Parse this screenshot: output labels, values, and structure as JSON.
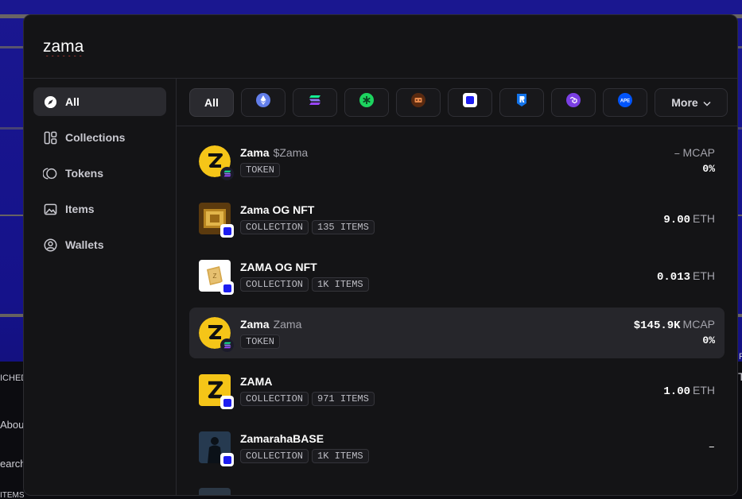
{
  "search": {
    "value": "zama",
    "placeholder": ""
  },
  "background": {
    "left_texts": [
      "ICHED",
      "Abou",
      "earch",
      "ITEMS"
    ],
    "right_texts": [
      "F",
      "T"
    ]
  },
  "sidebar": {
    "items": [
      {
        "label": "All",
        "icon": "compass-icon",
        "active": true
      },
      {
        "label": "Collections",
        "icon": "grid-icon",
        "active": false
      },
      {
        "label": "Tokens",
        "icon": "coins-icon",
        "active": false
      },
      {
        "label": "Items",
        "icon": "image-icon",
        "active": false
      },
      {
        "label": "Wallets",
        "icon": "user-circle-icon",
        "active": false
      }
    ]
  },
  "chains": {
    "all_label": "All",
    "more_label": "More",
    "icons": [
      "ethereum-icon",
      "solana-icon",
      "chain-green-icon",
      "chain-brown-icon",
      "base-icon",
      "ronin-icon",
      "polygon-icon",
      "apechain-icon"
    ]
  },
  "results": [
    {
      "name": "Zama",
      "sub": "$Zama",
      "tags": [
        "TOKEN"
      ],
      "value": "–",
      "unit": "MCAP",
      "change": "0%",
      "thumb": "zama-logo",
      "chain": "solana"
    },
    {
      "name": "Zama OG NFT",
      "sub": "",
      "tags": [
        "COLLECTION",
        "135 ITEMS"
      ],
      "value": "9.00",
      "unit": "ETH",
      "change": "",
      "thumb": "gold-box",
      "chain": "base"
    },
    {
      "name": "ZAMA OG NFT",
      "sub": "",
      "tags": [
        "COLLECTION",
        "1K ITEMS"
      ],
      "value": "0.013",
      "unit": "ETH",
      "change": "",
      "thumb": "gold-card",
      "chain": "base"
    },
    {
      "name": "Zama",
      "sub": "Zama",
      "tags": [
        "TOKEN"
      ],
      "value": "$145.9K",
      "unit": "MCAP",
      "change": "0%",
      "thumb": "zama-logo",
      "chain": "solana",
      "highlighted": true
    },
    {
      "name": "ZAMA",
      "sub": "",
      "tags": [
        "COLLECTION",
        "971 ITEMS"
      ],
      "value": "1.00",
      "unit": "ETH",
      "change": "",
      "thumb": "zama-square",
      "chain": "base"
    },
    {
      "name": "ZamarahaBASE",
      "sub": "",
      "tags": [
        "COLLECTION",
        "1K ITEMS"
      ],
      "value": "–",
      "unit": "",
      "change": "",
      "thumb": "dark-figure",
      "chain": "base"
    }
  ],
  "colors": {
    "accent_yellow": "#f5c518",
    "base_blue": "#1d1df0",
    "highlight": "#26262b"
  }
}
